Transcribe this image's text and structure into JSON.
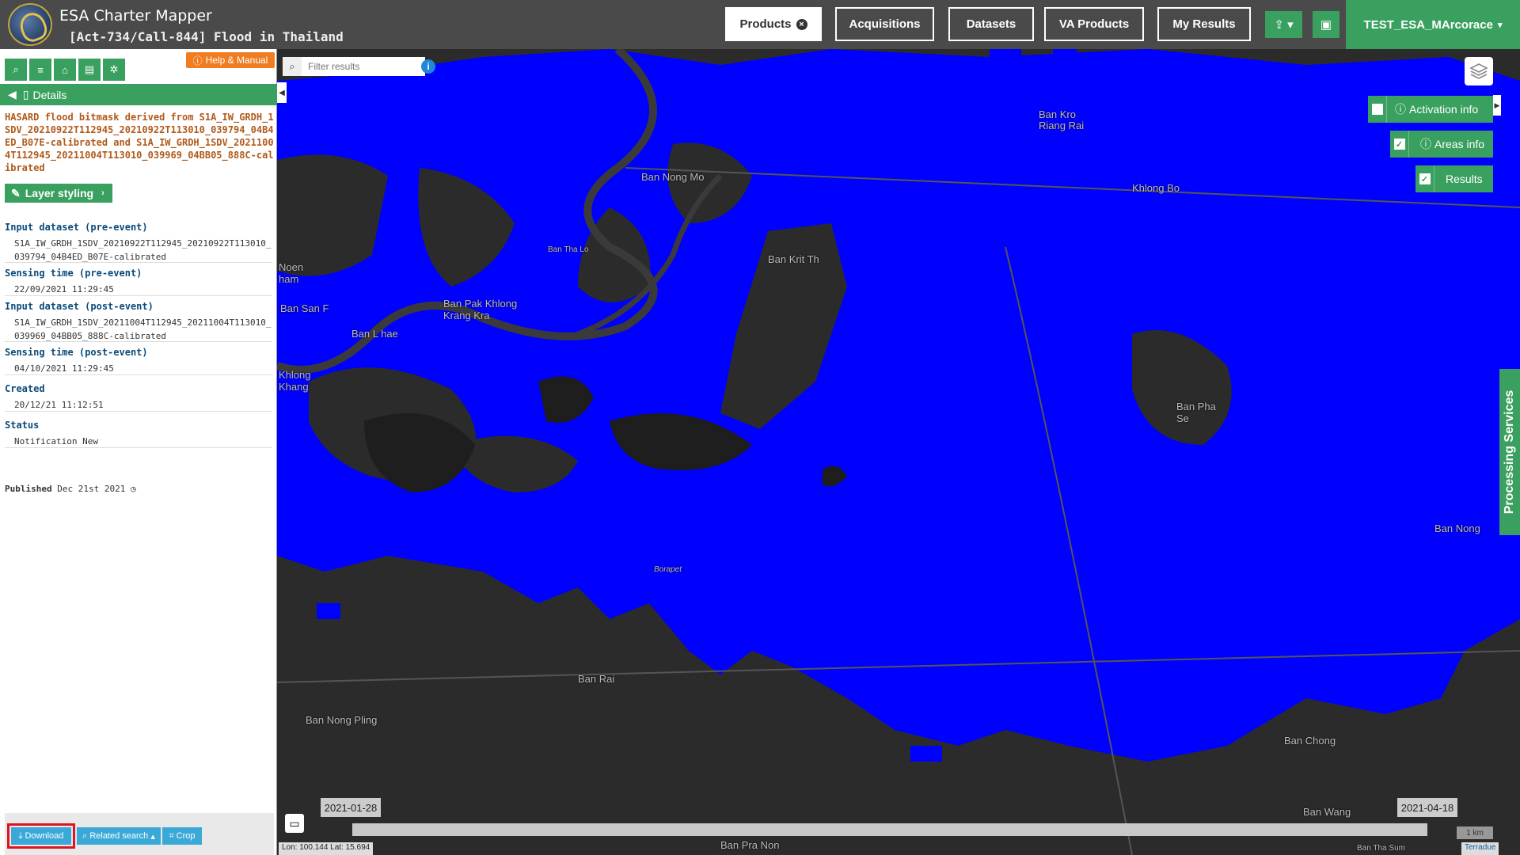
{
  "header": {
    "app_title": "ESA Charter Mapper",
    "subtitle": "[Act-734/Call-844] Flood in Thailand",
    "nav": [
      {
        "label": "Products",
        "active": true
      },
      {
        "label": "Acquisitions"
      },
      {
        "label": "Datasets"
      },
      {
        "label": "VA Products"
      },
      {
        "label": "My Results"
      }
    ],
    "upload_icon": "upload-icon",
    "briefcase_icon": "briefcase-icon",
    "user": "TEST_ESA_MArcorace"
  },
  "left_panel": {
    "help_label": "Help & Manual",
    "details_label": "Details",
    "product_title": "HASARD flood bitmask derived from S1A_IW_GRDH_1SDV_20210922T112945_20210922T113010_039794_04B4ED_B07E-calibrated and S1A_IW_GRDH_1SDV_20211004T112945_20211004T113010_039969_04BB05_888C-calibrated",
    "layer_styling_label": "Layer styling",
    "fields": [
      {
        "label": "Input dataset (pre-event)",
        "value": "S1A_IW_GRDH_1SDV_20210922T112945_20210922T113010_039794_04B4ED_B07E-calibrated"
      },
      {
        "label": "Sensing time (pre-event)",
        "value": "22/09/2021 11:29:45"
      },
      {
        "label": "Input dataset (post-event)",
        "value": "S1A_IW_GRDH_1SDV_20211004T112945_20211004T113010_039969_04BB05_888C-calibrated"
      },
      {
        "label": "Sensing time (post-event)",
        "value": "04/10/2021 11:29:45"
      },
      {
        "label": "Created",
        "value": "20/12/21 11:12:51"
      },
      {
        "label": "Status",
        "value": "Notification New"
      }
    ],
    "published_label": "Published",
    "published_value": "Dec 21st 2021",
    "actions": {
      "download": "Download",
      "related_search": "Related search",
      "crop": "Crop"
    }
  },
  "map": {
    "filter_placeholder": "Filter results",
    "overlays": {
      "activation_info": "Activation info",
      "areas_info": "Areas info",
      "results": "Results"
    },
    "processing_services": "Processing Services",
    "places": [
      "Ban Kro Riang Rai",
      "Ban Nong Mo",
      "Khlong Bo",
      "Ban Tha Lo",
      "Ban Krit Th",
      "Noen ham",
      "Ban San F",
      "Ban Pak Khlong Krang Kra",
      "Ban L hae",
      "Khlong Khang",
      "Ban Pha Se",
      "Ban Nong",
      "Borapet",
      "Ban Rai",
      "Ban Nong Pling",
      "Ban Chong",
      "Ban Wang",
      "Ban Pra Non",
      "Ban Tha Sum",
      "Ban Rai"
    ],
    "timeline": {
      "start": "2021-01-28",
      "end": "2021-04-18"
    },
    "coords": "Lon: 100.144 Lat: 15.694",
    "scale": "1 km",
    "attribution": "Terradue",
    "colors": {
      "flood": "#0000ff",
      "base": "#2b2b2b",
      "accent": "#3aa05f"
    }
  }
}
